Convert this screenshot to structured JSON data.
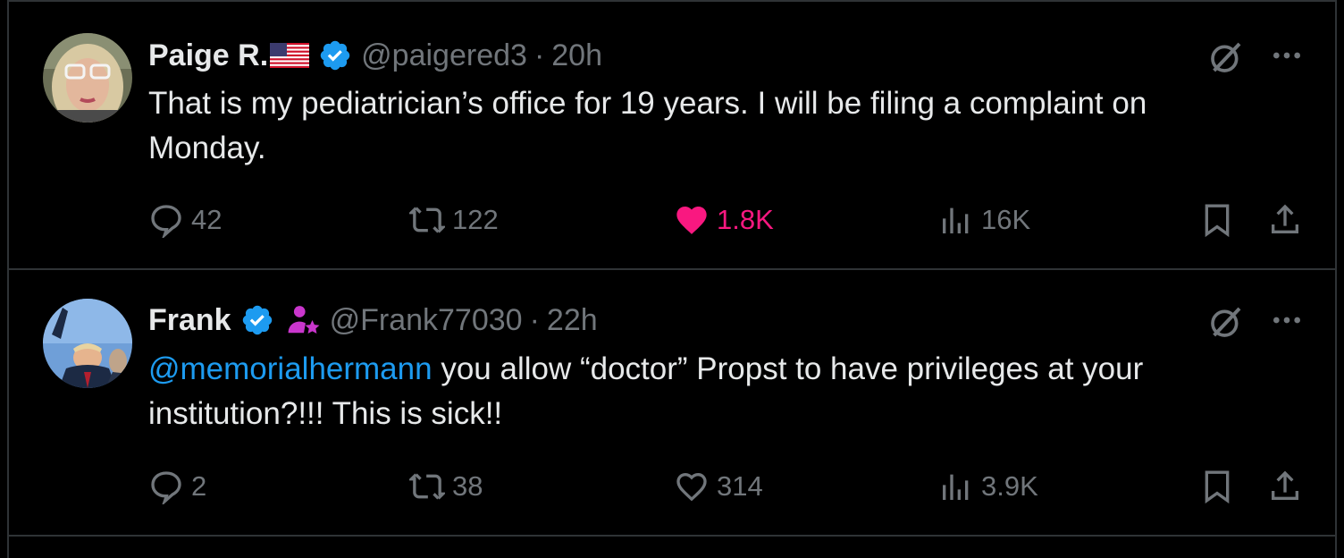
{
  "tweets": [
    {
      "name": "Paige R.",
      "handle": "@paigered3",
      "dot": "·",
      "time": "20h",
      "body_text": "That is my pediatrician’s office for 19 years. I will be filing a complaint on Monday.",
      "mention": "",
      "replies": "42",
      "reposts": "122",
      "likes": "1.8K",
      "liked": true,
      "views": "16K"
    },
    {
      "name": "Frank",
      "handle": "@Frank77030",
      "dot": "·",
      "time": "22h",
      "mention": "@memorialhermann",
      "body_text": " you allow “doctor” Propst to have privileges at your institution?!!! This is sick!!",
      "replies": "2",
      "reposts": "38",
      "likes": "314",
      "liked": false,
      "views": "3.9K"
    }
  ],
  "colors": {
    "background": "#000000",
    "text": "#e7e9ea",
    "muted": "#71767b",
    "accent": "#1d9bf0",
    "like": "#f91880",
    "subscriber_badge": "#c936cc"
  },
  "icons": [
    "grok-icon",
    "more-icon",
    "reply-icon",
    "repost-icon",
    "like-icon",
    "views-icon",
    "bookmark-icon",
    "share-icon",
    "verified-badge-icon",
    "us-flag-icon",
    "subscriber-badge-icon"
  ]
}
